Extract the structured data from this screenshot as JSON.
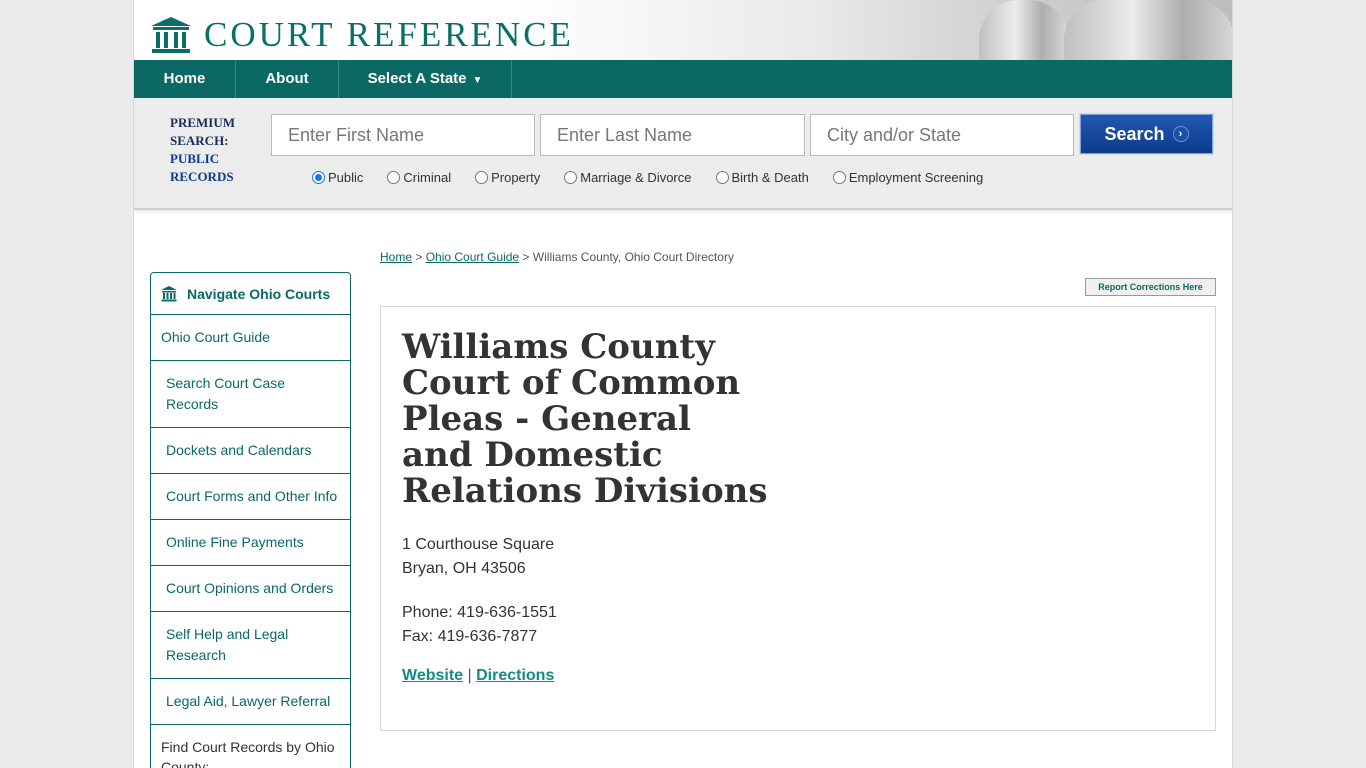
{
  "site": {
    "logo_text": "COURT REFERENCE",
    "logo_icon": "courthouse-icon"
  },
  "nav": {
    "home": "Home",
    "about": "About",
    "select_state": "Select A State",
    "caret": "▼"
  },
  "search": {
    "premium_label": "PREMIUM SEARCH:",
    "premium_sub": "PUBLIC RECORDS",
    "first_name_placeholder": "Enter First Name",
    "last_name_placeholder": "Enter Last Name",
    "city_state_placeholder": "City and/or State",
    "button_label": "Search",
    "button_arrow": "›",
    "radios": [
      {
        "label": "Public",
        "selected": true
      },
      {
        "label": "Criminal",
        "selected": false
      },
      {
        "label": "Property",
        "selected": false
      },
      {
        "label": "Marriage & Divorce",
        "selected": false
      },
      {
        "label": "Birth & Death",
        "selected": false
      },
      {
        "label": "Employment Screening",
        "selected": false
      }
    ]
  },
  "breadcrumb": {
    "home": "Home",
    "sep": " > ",
    "guide": "Ohio Court Guide",
    "current": "Williams County, Ohio Court Directory"
  },
  "report_corrections": "Report Corrections Here",
  "sidebar": {
    "heading": "Navigate Ohio Courts",
    "heading_icon": "courthouse-icon",
    "guide": "Ohio Court Guide",
    "items": [
      "Search Court Case Records",
      "Dockets and Calendars",
      "Court Forms and Other Info",
      "Online Fine Payments",
      "Court Opinions and Orders",
      "Self Help and Legal Research",
      "Legal Aid, Lawyer Referral"
    ],
    "find_by_county": "Find Court Records by Ohio County:"
  },
  "court": {
    "title": "Williams County Court of Common Pleas - General and Domestic Relations Divisions",
    "address_line1": "1 Courthouse Square",
    "address_line2": "Bryan, OH 43506",
    "phone": "Phone: 419-636-1551",
    "fax": "Fax: 419-636-7877",
    "website_label": "Website",
    "separator": " | ",
    "directions_label": "Directions"
  },
  "colors": {
    "brand_teal": "#0b6864",
    "search_button": "#0b3b8a",
    "link_teal": "#138c87"
  }
}
